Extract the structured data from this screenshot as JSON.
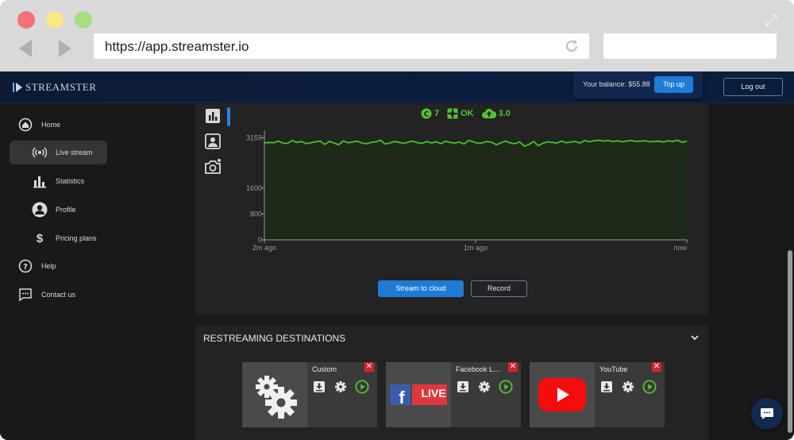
{
  "browser": {
    "url": "https://app.streamster.io",
    "search_value": ""
  },
  "app": {
    "logo_text": "STREAMSTER",
    "balance_label": "Your balance: $55.88",
    "topup_label": "Top up",
    "logout_label": "Log out"
  },
  "sidebar": {
    "items": [
      {
        "label": "Home",
        "icon": "home-icon"
      },
      {
        "label": "Live stream",
        "icon": "live-stream-icon"
      },
      {
        "label": "Statistics",
        "icon": "bar-chart-icon"
      },
      {
        "label": "Profile",
        "icon": "profile-icon"
      },
      {
        "label": "Pricing plans",
        "icon": "dollar-icon"
      },
      {
        "label": "Help",
        "icon": "help-icon"
      },
      {
        "label": "Contact us",
        "icon": "chat-icon"
      }
    ],
    "active_index": 1
  },
  "status": {
    "viewers": "7",
    "health": "OK",
    "upload": "3.0"
  },
  "chart_data": {
    "type": "line",
    "y_ticks": [
      0,
      800,
      1600,
      3159
    ],
    "ylim": [
      0,
      3200
    ],
    "x_tick_labels": [
      "2m ago",
      "1m ago",
      "now"
    ],
    "series": [
      {
        "values": [
          3000,
          3020,
          3010,
          3060,
          3000,
          2990,
          3080,
          3020,
          3050,
          2980,
          3010,
          3040,
          3060,
          2960,
          3050,
          3000,
          2950,
          3070,
          3010,
          3030,
          3060,
          3000,
          2980,
          3020,
          3040,
          3090,
          2970,
          3000,
          3050,
          3020,
          2990,
          3030,
          3060,
          3010,
          2990,
          3050,
          3000,
          3040,
          2980,
          3060,
          3020,
          3000,
          3030,
          2970,
          3080,
          3040,
          2990,
          3010,
          3050,
          3020,
          2950,
          3010,
          3060,
          3000,
          2980,
          3040,
          2900,
          2960,
          3050,
          2920,
          2990,
          3040,
          3020,
          3000,
          3060,
          3010,
          3030,
          3050,
          3000,
          3080,
          3040,
          3070,
          3090,
          3060,
          3080,
          3050,
          3070,
          3040,
          3060,
          3080,
          3050,
          3060,
          3070,
          3040,
          3050,
          3060,
          3030,
          3070,
          3050,
          3090,
          3020,
          3060
        ]
      }
    ],
    "colors": {
      "line": "#45c02b",
      "area": "#1d2a18",
      "axis": "#9a9a9a"
    }
  },
  "controls": {
    "stream_to_cloud": "Stream to cloud",
    "record": "Record"
  },
  "destinations": {
    "title": "RESTREAMING DESTINATIONS",
    "cards": [
      {
        "name": "Custom",
        "thumb": "custom-gears-icon"
      },
      {
        "name": "Facebook L...",
        "thumb": "facebook-live-logo",
        "badge": "LIVE"
      },
      {
        "name": "YouTube",
        "thumb": "youtube-logo"
      }
    ],
    "close_glyph": "✕"
  },
  "icons": {
    "expand": "⤢"
  }
}
